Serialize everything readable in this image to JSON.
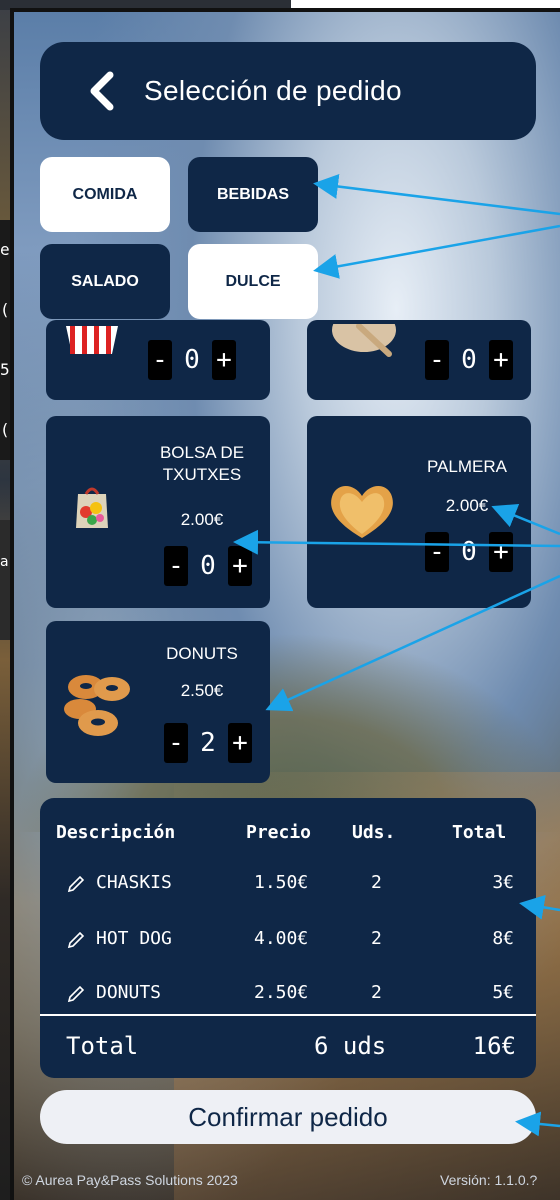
{
  "header": {
    "title": "Selección de pedido"
  },
  "categories": [
    {
      "label": "COMIDA",
      "active": true
    },
    {
      "label": "BEBIDAS",
      "active": false
    },
    {
      "label": "SALADO",
      "active": false
    },
    {
      "label": "DULCE",
      "active": true
    }
  ],
  "products": [
    {
      "name": "",
      "price": "",
      "qty": "0",
      "image": "popcorn-image"
    },
    {
      "name": "",
      "price": "",
      "qty": "0",
      "image": "snack-image"
    },
    {
      "name": "BOLSA DE TXUTXES",
      "price": "2.00€",
      "qty": "0",
      "image": "candy-bag-image"
    },
    {
      "name": "PALMERA",
      "price": "2.00€",
      "qty": "0",
      "image": "palmier-image"
    },
    {
      "name": "DONUTS",
      "price": "2.50€",
      "qty": "2",
      "image": "donuts-image"
    }
  ],
  "stepper": {
    "minus": "-",
    "plus": "+"
  },
  "order": {
    "headers": [
      "Descripción",
      "Precio",
      "Uds.",
      "Total"
    ],
    "rows": [
      {
        "desc": "CHASKIS",
        "price": "1.50€",
        "uds": "2",
        "total": "3€"
      },
      {
        "desc": "HOT DOG",
        "price": "4.00€",
        "uds": "2",
        "total": "8€"
      },
      {
        "desc": "DONUTS",
        "price": "2.50€",
        "uds": "2",
        "total": "5€"
      }
    ],
    "total_label": "Total",
    "total_uds": "6 uds",
    "total_amount": "16€"
  },
  "confirm_label": "Confirmar pedido",
  "footer": {
    "copyright": "© Aurea Pay&Pass Solutions 2023",
    "version": "Versión: 1.1.0.?"
  },
  "left_peek": [
    "e",
    "(",
    "5",
    "("
  ],
  "left_peek_2": "a",
  "colors": {
    "navy": "#0f2747",
    "white": "#ffffff",
    "arrow": "#1aa3e8"
  }
}
